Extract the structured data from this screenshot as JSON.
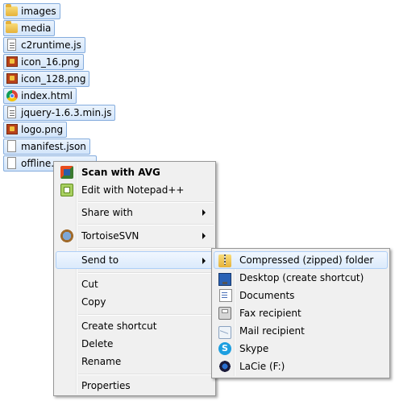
{
  "files": [
    {
      "name": "images",
      "icon": "folder-icon"
    },
    {
      "name": "media",
      "icon": "folder-icon"
    },
    {
      "name": "c2runtime.js",
      "icon": "js-file-icon"
    },
    {
      "name": "icon_16.png",
      "icon": "image-file-icon"
    },
    {
      "name": "icon_128.png",
      "icon": "image-file-icon"
    },
    {
      "name": "index.html",
      "icon": "chrome-icon"
    },
    {
      "name": "jquery-1.6.3.min.js",
      "icon": "js-file-icon"
    },
    {
      "name": "logo.png",
      "icon": "image-file-icon"
    },
    {
      "name": "manifest.json",
      "icon": "file-icon"
    },
    {
      "name": "offline.a",
      "icon": "file-icon"
    }
  ],
  "context_menu": {
    "items": {
      "scan_avg": "Scan with AVG",
      "edit_notepad": "Edit with Notepad++",
      "share_with": "Share with",
      "tortoise_svn": "TortoiseSVN",
      "send_to": "Send to",
      "cut": "Cut",
      "copy": "Copy",
      "create_shortcut": "Create shortcut",
      "delete": "Delete",
      "rename": "Rename",
      "properties": "Properties"
    }
  },
  "send_to_menu": {
    "items": {
      "compressed": "Compressed (zipped) folder",
      "desktop": "Desktop (create shortcut)",
      "documents": "Documents",
      "fax": "Fax recipient",
      "mail": "Mail recipient",
      "skype": "Skype",
      "lacie": "LaCie (F:)"
    }
  },
  "colors": {
    "selection_border": "#84acdd",
    "menu_bg": "#f0f0f0",
    "highlight_border": "#aecff7"
  }
}
